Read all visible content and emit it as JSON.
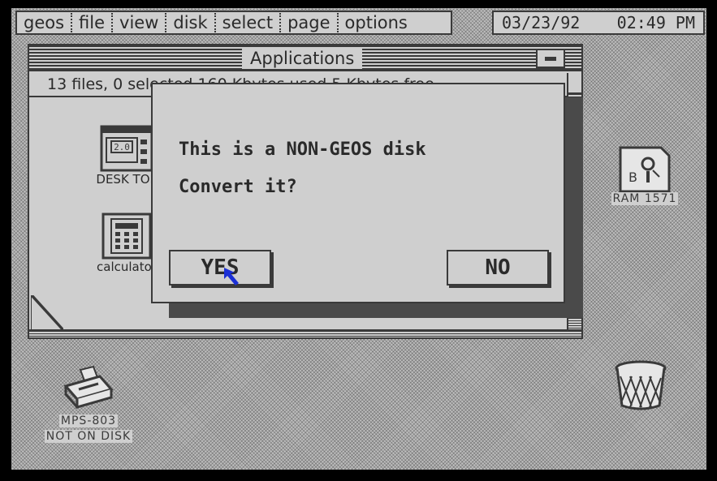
{
  "menu": {
    "items": [
      "geos",
      "file",
      "view",
      "disk",
      "select",
      "page",
      "options"
    ]
  },
  "clock": {
    "date": "03/23/92",
    "time": "02:49 PM"
  },
  "window": {
    "title": "Applications",
    "info": "13 files,   0 selected   160 Kbytes used   5 Kbytes free",
    "icons": [
      {
        "label": "DESK TOP",
        "badge": "2.0"
      },
      {
        "label": "calculator"
      }
    ]
  },
  "dialog": {
    "line1": "This is a NON-GEOS disk",
    "line2": "Convert it?",
    "yes_label": "YES",
    "no_label": "NO"
  },
  "desktop": {
    "ram_label": "RAM 1571",
    "ram_letter": "B",
    "printer_label": "MPS-803",
    "printer_sublabel": "NOT ON DISK"
  },
  "colors": {
    "background": "#bdbdbd",
    "panel": "#cfcfcf",
    "ink": "#3a3a3a",
    "shadow": "#4a4a4a",
    "cursor": "#1a2fd6"
  }
}
